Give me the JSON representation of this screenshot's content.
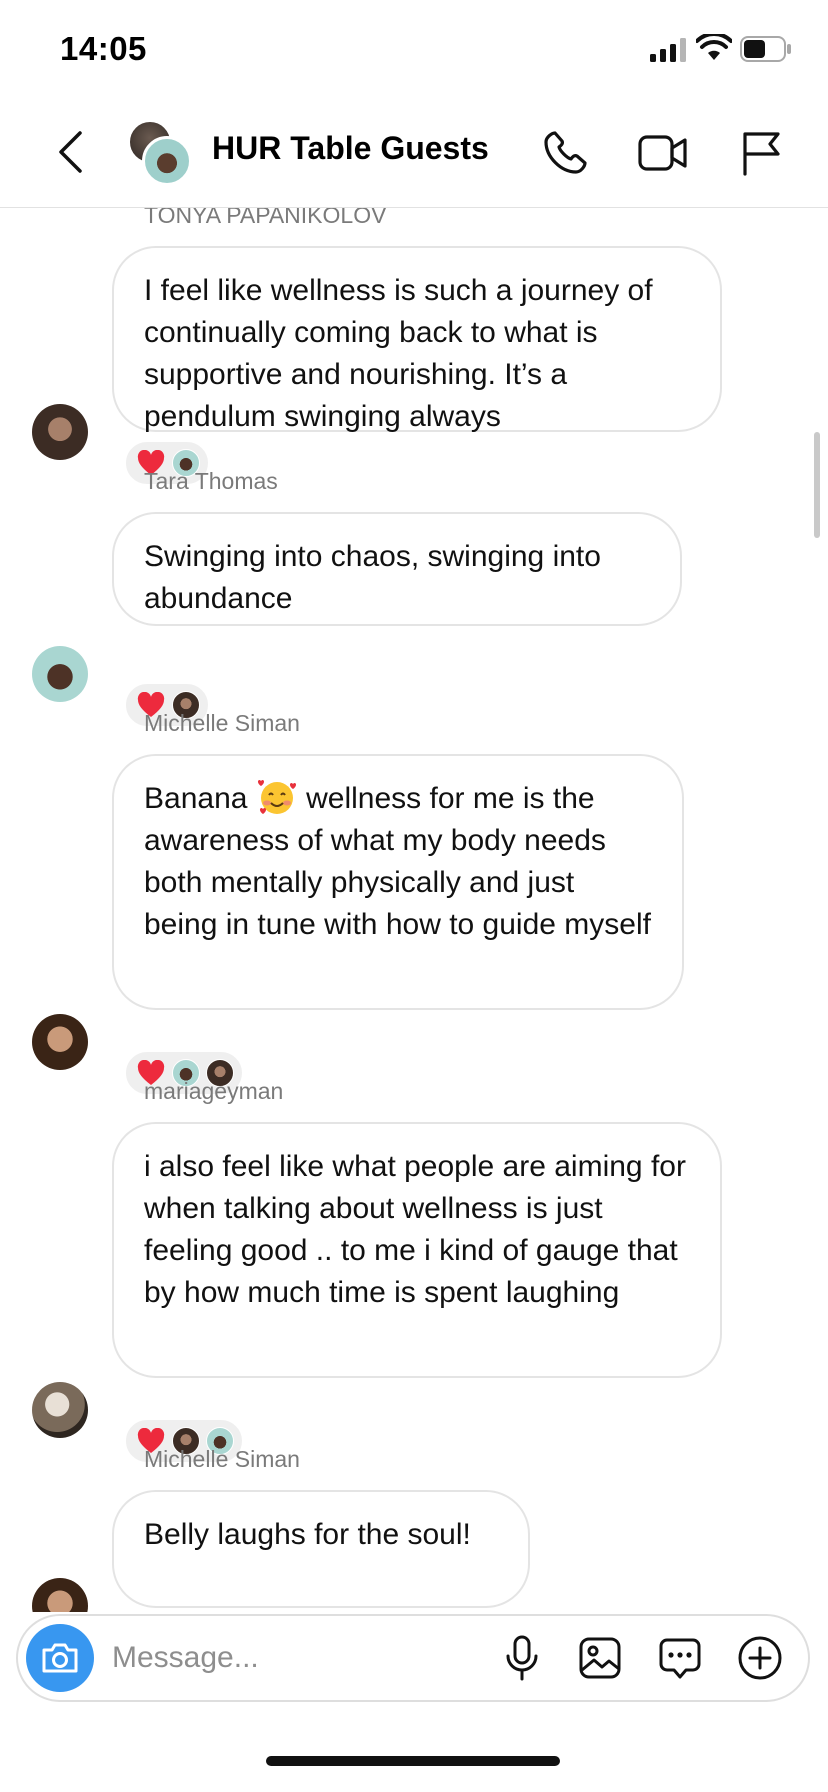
{
  "status_bar": {
    "time": "14:05",
    "battery_level": 0.55
  },
  "header": {
    "title": "HUR Table Guests",
    "icons": [
      "back-arrow-icon",
      "phone-icon",
      "video-camera-icon",
      "flag-icon"
    ]
  },
  "messages": [
    {
      "sender": "TONYA PAPANIKOLOV",
      "text": "I feel like wellness is such a journey of continually coming back to what is supportive and nourishing. It’s a pendulum swinging always",
      "reactions": [
        "red-heart-icon",
        "avatar-tara"
      ]
    },
    {
      "sender": "Tara Thomas",
      "text": "Swinging into chaos, swinging into abundance",
      "reactions": [
        "red-heart-icon",
        "avatar-tonya"
      ]
    },
    {
      "sender": "Michelle Siman",
      "text_before_emoji": "Banana",
      "text_after_emoji": "wellness for me is the awareness of what my body needs both mentally physically and just being in tune with how to guide myself",
      "emoji": "smiling-face-with-hearts-icon",
      "reactions": [
        "red-heart-icon",
        "avatar-tara",
        "avatar-tonya"
      ]
    },
    {
      "sender": "mariageyman",
      "text": "i also feel like what people are aiming for when talking about wellness is just feeling good .. to me i kind of gauge that by how much time is spent laughing",
      "reactions": [
        "red-heart-icon",
        "avatar-tonya",
        "avatar-tara"
      ]
    },
    {
      "sender": "Michelle Siman",
      "text": "Belly laughs for the soul!"
    }
  ],
  "composer": {
    "placeholder": "Message...",
    "icons": [
      "camera-icon",
      "microphone-icon",
      "gallery-icon",
      "sticker-icon",
      "plus-icon"
    ]
  },
  "colors": {
    "accent": "#3897f0",
    "heart": "#ed2a3d",
    "bubble_border": "#e4e4e4",
    "sender_gray": "#7a7a7a"
  }
}
